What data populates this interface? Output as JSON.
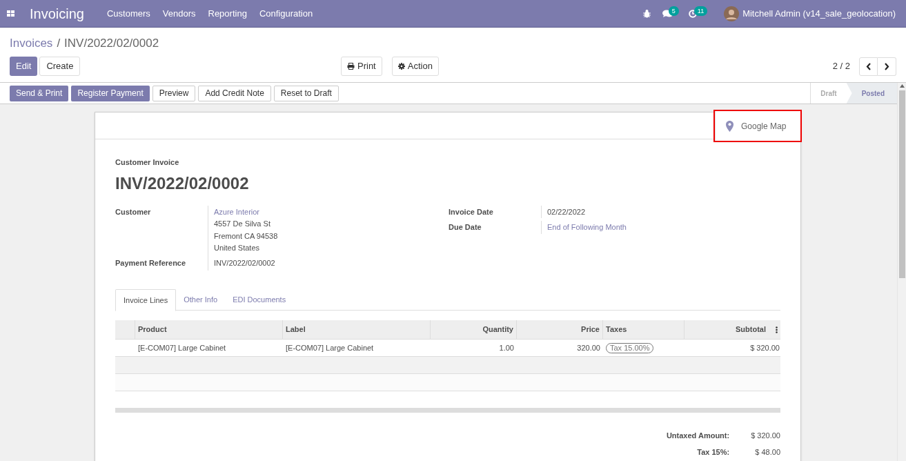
{
  "navbar": {
    "app_title": "Invoicing",
    "menu": [
      "Customers",
      "Vendors",
      "Reporting",
      "Configuration"
    ],
    "messages_count": "5",
    "activities_count": "11",
    "user": "Mitchell Admin (v14_sale_geolocation)"
  },
  "breadcrumb": {
    "parent": "Invoices",
    "separator": "/",
    "current": "INV/2022/02/0002"
  },
  "main_buttons": [
    {
      "label": "Edit",
      "primary": true
    },
    {
      "label": "Create",
      "primary": false
    }
  ],
  "sidebar_buttons": [
    {
      "label": "Print",
      "kind": "print"
    },
    {
      "label": "Action",
      "kind": "gear"
    }
  ],
  "pager": {
    "value": "2 / 2"
  },
  "header_buttons": [
    {
      "label": "Send & Print",
      "primary": true
    },
    {
      "label": "Register Payment",
      "primary": true
    },
    {
      "label": "Preview",
      "primary": false
    },
    {
      "label": "Add Credit Note",
      "primary": false
    },
    {
      "label": "Reset to Draft",
      "primary": false
    }
  ],
  "stages": [
    {
      "label": "Draft",
      "selected": false
    },
    {
      "label": "Posted",
      "selected": true
    }
  ],
  "smart_button": {
    "label": "Google Map"
  },
  "sheet": {
    "type_label": "Customer Invoice",
    "name": "INV/2022/02/0002",
    "left_fields": [
      {
        "label": "Customer",
        "lines": [
          "Azure Interior",
          "4557 De Silva St",
          "Fremont CA 94538",
          "United States"
        ]
      },
      {
        "label": "Payment Reference",
        "lines": [
          "INV/2022/02/0002"
        ]
      }
    ],
    "right_fields": [
      {
        "label": "Invoice Date",
        "value": "02/22/2022",
        "link": false
      },
      {
        "label": "Due Date",
        "value": "End of Following Month",
        "link": true
      }
    ],
    "tabs": [
      {
        "label": "Invoice Lines",
        "selected": true
      },
      {
        "label": "Other Info",
        "selected": false
      },
      {
        "label": "EDI Documents",
        "selected": false
      }
    ],
    "table": {
      "columns": [
        "Product",
        "Label",
        "Quantity",
        "Price",
        "Taxes",
        "Subtotal"
      ],
      "rows": [
        {
          "product": "[E-COM07] Large Cabinet",
          "label": "[E-COM07] Large Cabinet",
          "quantity": "1.00",
          "price": "320.00",
          "taxes": "Tax 15.00%",
          "subtotal": "$ 320.00"
        }
      ]
    },
    "totals": [
      {
        "label": "Untaxed Amount:",
        "value": "$ 320.00"
      },
      {
        "label": "Tax 15%:",
        "value": "$ 48.00"
      }
    ]
  }
}
